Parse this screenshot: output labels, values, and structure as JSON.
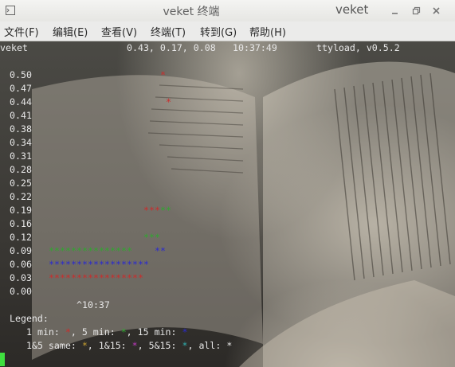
{
  "window": {
    "title": "veket 终端",
    "title_right": "veket",
    "buttons": {
      "minimize": "minimize-icon",
      "restore": "restore-icon",
      "close": "close-icon"
    }
  },
  "menu": [
    {
      "label": "文件(F)"
    },
    {
      "label": "编辑(E)"
    },
    {
      "label": "查看(V)"
    },
    {
      "label": "终端(T)"
    },
    {
      "label": "转到(G)"
    },
    {
      "label": "帮助(H)"
    }
  ],
  "terminal": {
    "header": {
      "host": "veket",
      "loadavg": "0.43, 0.17, 0.08",
      "time": "10:37:49",
      "program": "ttyload, v0.5.2"
    },
    "y_labels": [
      "0.50",
      "0.47",
      "0.44",
      "0.41",
      "0.38",
      "0.34",
      "0.31",
      "0.28",
      "0.25",
      "0.22",
      "0.19",
      "0.16",
      "0.12",
      "0.09",
      "0.06",
      "0.03",
      "0.00"
    ],
    "time_marker": "^10:37",
    "legend_title": "Legend:",
    "legend_line1": {
      "one_min": "1 min:",
      "five_min": ", 5 min:",
      "fifteen_min": ", 15 min:"
    },
    "legend_line2": {
      "same_1_5": "1&5 same:",
      "same_1_15": ", 1&15:",
      "same_5_15": ", 5&15:",
      "all": ", all:"
    },
    "star_char": "*"
  },
  "chart_data": {
    "type": "scatter",
    "title": "",
    "ylabel": "",
    "xlabel": "",
    "ylim": [
      0.0,
      0.5
    ],
    "y_ticks": [
      0.5,
      0.47,
      0.44,
      0.41,
      0.38,
      0.34,
      0.31,
      0.28,
      0.25,
      0.22,
      0.19,
      0.16,
      0.12,
      0.09,
      0.06,
      0.03,
      0.0
    ],
    "series": [
      {
        "name": "1 min",
        "color": "#cc2b2b",
        "points": [
          {
            "col": 0,
            "y": 0.03
          },
          {
            "col": 1,
            "y": 0.03
          },
          {
            "col": 2,
            "y": 0.03
          },
          {
            "col": 3,
            "y": 0.03
          },
          {
            "col": 4,
            "y": 0.03
          },
          {
            "col": 5,
            "y": 0.03
          },
          {
            "col": 6,
            "y": 0.03
          },
          {
            "col": 7,
            "y": 0.03
          },
          {
            "col": 8,
            "y": 0.03
          },
          {
            "col": 9,
            "y": 0.03
          },
          {
            "col": 10,
            "y": 0.03
          },
          {
            "col": 11,
            "y": 0.03
          },
          {
            "col": 12,
            "y": 0.03
          },
          {
            "col": 13,
            "y": 0.03
          },
          {
            "col": 14,
            "y": 0.03
          },
          {
            "col": 15,
            "y": 0.03
          },
          {
            "col": 16,
            "y": 0.03
          },
          {
            "col": 17,
            "y": 0.19
          },
          {
            "col": 18,
            "y": 0.19
          },
          {
            "col": 19,
            "y": 0.19
          },
          {
            "col": 20,
            "y": 0.5
          },
          {
            "col": 21,
            "y": 0.44
          }
        ]
      },
      {
        "name": "5 min",
        "color": "#2fa82f",
        "points": [
          {
            "col": 0,
            "y": 0.09
          },
          {
            "col": 1,
            "y": 0.09
          },
          {
            "col": 2,
            "y": 0.09
          },
          {
            "col": 3,
            "y": 0.09
          },
          {
            "col": 4,
            "y": 0.09
          },
          {
            "col": 5,
            "y": 0.09
          },
          {
            "col": 6,
            "y": 0.09
          },
          {
            "col": 7,
            "y": 0.09
          },
          {
            "col": 8,
            "y": 0.09
          },
          {
            "col": 9,
            "y": 0.09
          },
          {
            "col": 10,
            "y": 0.09
          },
          {
            "col": 11,
            "y": 0.09
          },
          {
            "col": 12,
            "y": 0.09
          },
          {
            "col": 13,
            "y": 0.09
          },
          {
            "col": 14,
            "y": 0.09
          },
          {
            "col": 17,
            "y": 0.12
          },
          {
            "col": 18,
            "y": 0.12
          },
          {
            "col": 19,
            "y": 0.12
          },
          {
            "col": 20,
            "y": 0.19
          },
          {
            "col": 21,
            "y": 0.19
          }
        ]
      },
      {
        "name": "15 min",
        "color": "#2a2ad0",
        "points": [
          {
            "col": 0,
            "y": 0.06
          },
          {
            "col": 1,
            "y": 0.06
          },
          {
            "col": 2,
            "y": 0.06
          },
          {
            "col": 3,
            "y": 0.06
          },
          {
            "col": 4,
            "y": 0.06
          },
          {
            "col": 5,
            "y": 0.06
          },
          {
            "col": 6,
            "y": 0.06
          },
          {
            "col": 7,
            "y": 0.06
          },
          {
            "col": 8,
            "y": 0.06
          },
          {
            "col": 9,
            "y": 0.06
          },
          {
            "col": 10,
            "y": 0.06
          },
          {
            "col": 11,
            "y": 0.06
          },
          {
            "col": 12,
            "y": 0.06
          },
          {
            "col": 13,
            "y": 0.06
          },
          {
            "col": 14,
            "y": 0.06
          },
          {
            "col": 15,
            "y": 0.06
          },
          {
            "col": 16,
            "y": 0.06
          },
          {
            "col": 17,
            "y": 0.06
          },
          {
            "col": 19,
            "y": 0.09
          },
          {
            "col": 20,
            "y": 0.09
          }
        ]
      }
    ],
    "legend": [
      {
        "label": "1 min",
        "color": "#cc2b2b"
      },
      {
        "label": "5 min",
        "color": "#2fa82f"
      },
      {
        "label": "15 min",
        "color": "#2a2ad0"
      },
      {
        "label": "1&5 same",
        "color": "#c8a030"
      },
      {
        "label": "1&15",
        "color": "#c03ac0"
      },
      {
        "label": "5&15",
        "color": "#30b0b0"
      },
      {
        "label": "all",
        "color": "#e8e8e8"
      }
    ]
  }
}
